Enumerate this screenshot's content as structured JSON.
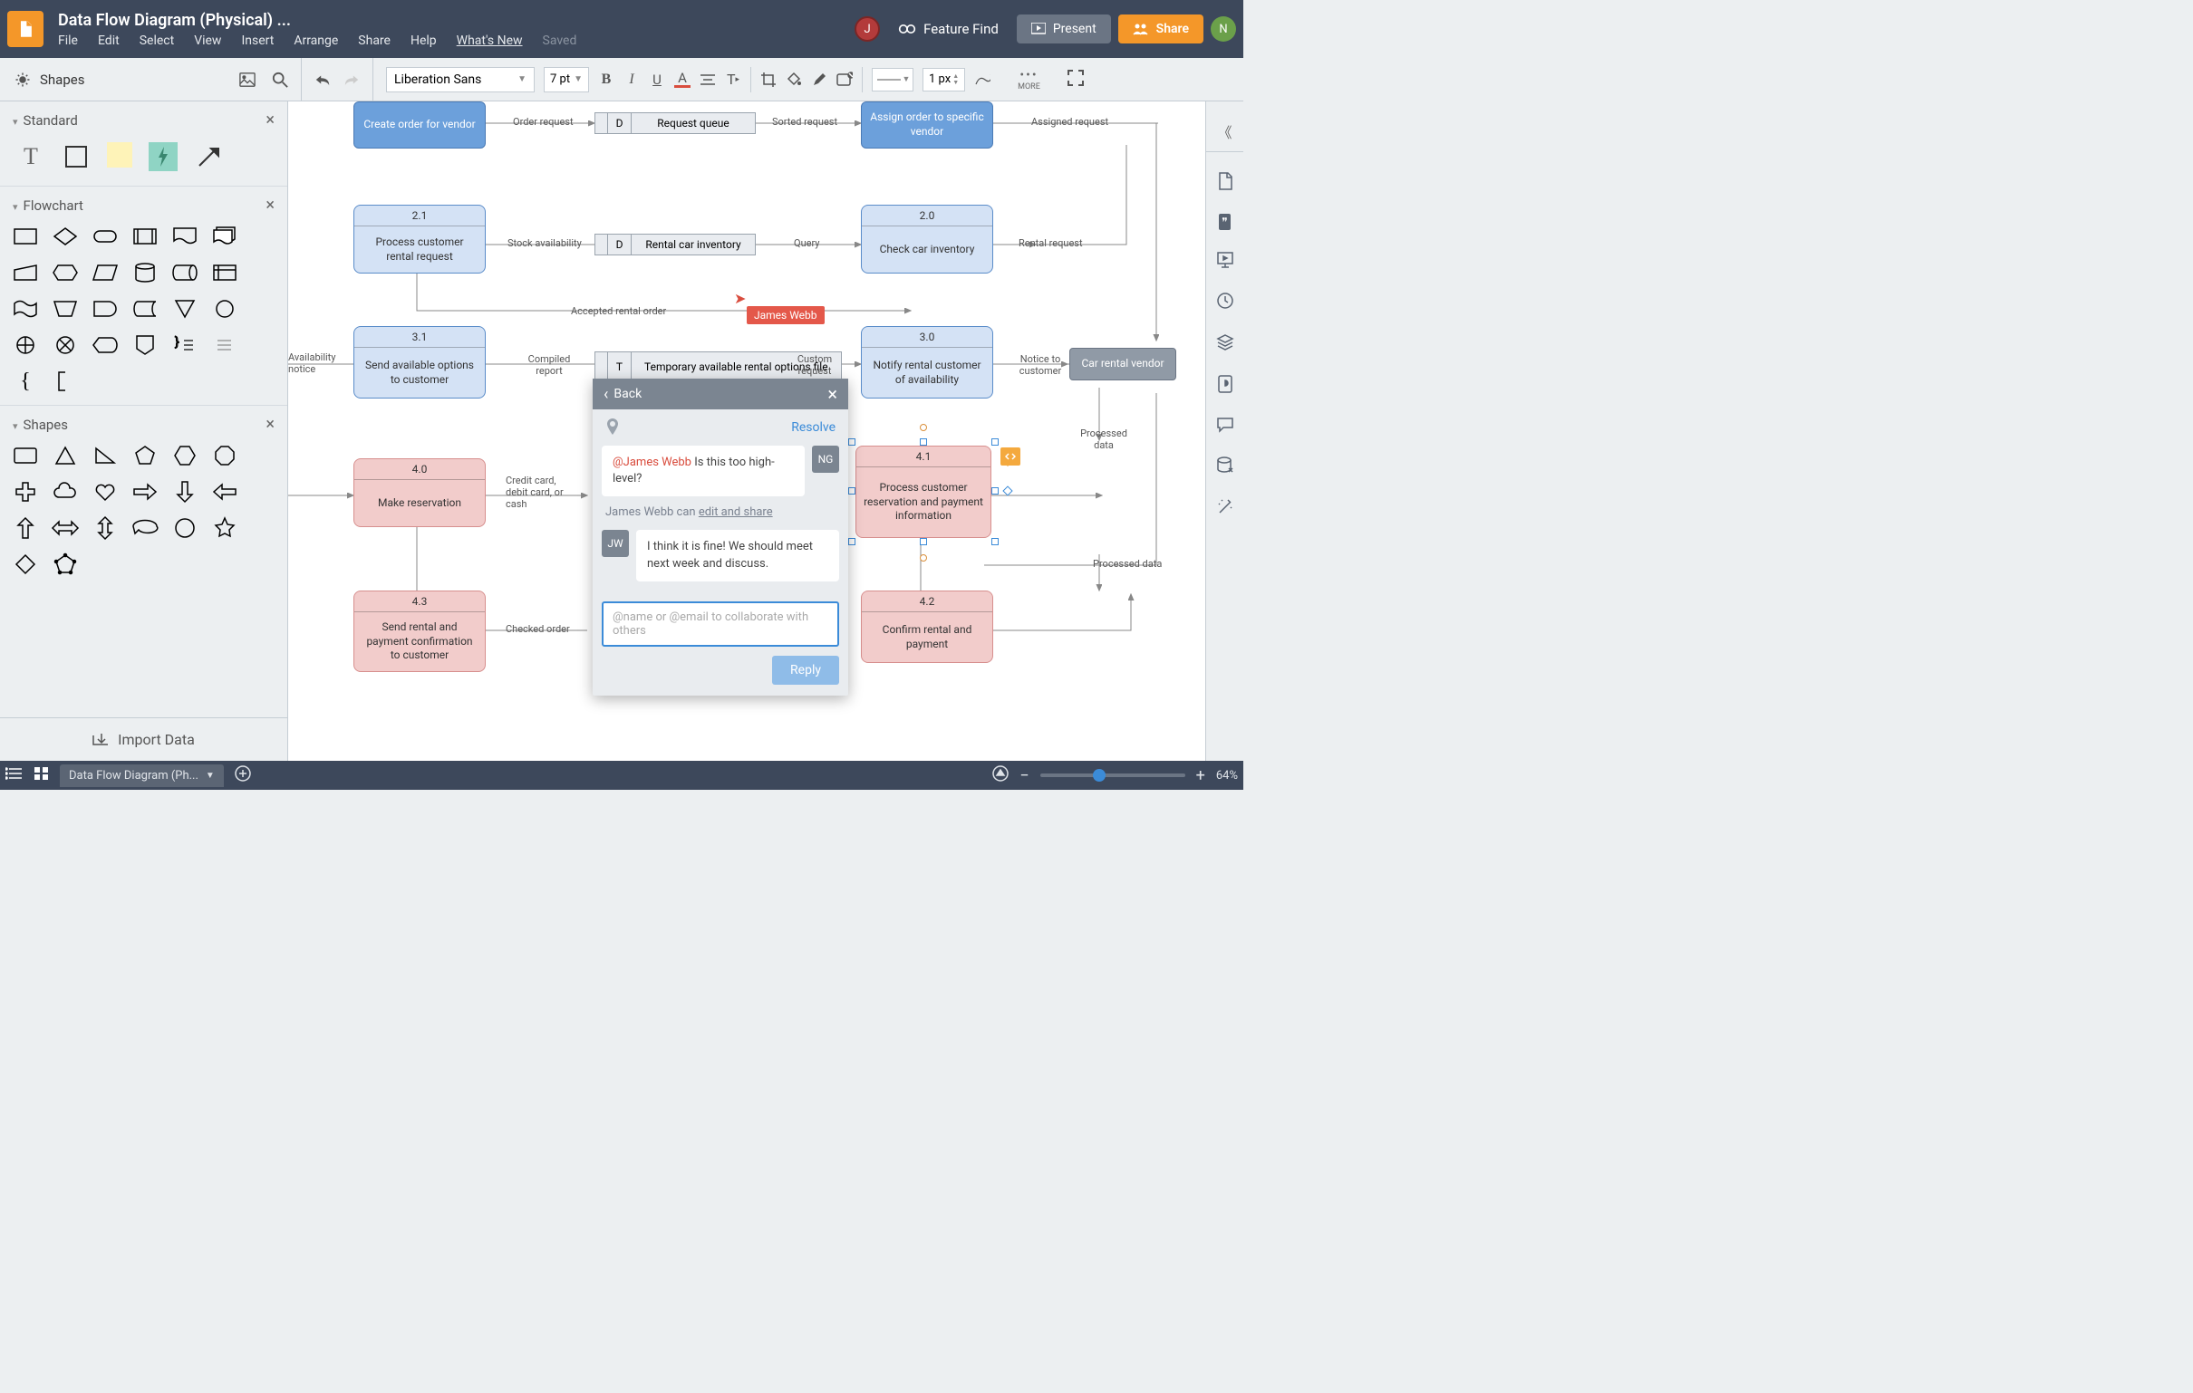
{
  "header": {
    "doc_title": "Data Flow Diagram (Physical) ...",
    "menu": [
      "File",
      "Edit",
      "Select",
      "View",
      "Insert",
      "Arrange",
      "Share",
      "Help",
      "What's New"
    ],
    "saved": "Saved",
    "feature_find": "Feature Find",
    "present": "Present",
    "share": "Share",
    "avatar_j": "J",
    "avatar_n": "N"
  },
  "toolbar": {
    "shapes_label": "Shapes",
    "font": "Liberation Sans",
    "font_size": "7 pt",
    "line_width": "1 px",
    "more": "MORE"
  },
  "left_panel": {
    "standard": "Standard",
    "flowchart": "Flowchart",
    "shapes": "Shapes",
    "import": "Import Data"
  },
  "canvas": {
    "cursor_user": "James Webb",
    "nodes": {
      "create_order": "Create order for vendor",
      "assign_order": "Assign order to specific vendor",
      "n21_num": "2.1",
      "n21_label": "Process customer rental request",
      "n20_num": "2.0",
      "n20_label": "Check car inventory",
      "n31_num": "3.1",
      "n31_label": "Send available options to customer",
      "n30_num": "3.0",
      "n30_label": "Notify rental customer of availability",
      "n40_num": "4.0",
      "n40_label": "Make reservation",
      "n41_num": "4.1",
      "n41_label": "Process customer reservation and payment information",
      "n43_num": "4.3",
      "n43_label": "Send rental and payment confirmation to customer",
      "n42_num": "4.2",
      "n42_label": "Confirm rental and payment",
      "vendor": "Car rental vendor"
    },
    "datastores": {
      "d1_letter": "D",
      "d1_label": "Request queue",
      "d2_letter": "D",
      "d2_label": "Rental car inventory",
      "t1_letter": "T",
      "t1_label": "Temporary available rental options file"
    },
    "edges": {
      "order_request": "Order request",
      "sorted_request": "Sorted request",
      "assigned_request": "Assigned request",
      "stock_availability": "Stock availability",
      "query": "Query",
      "rental_request": "Rental request",
      "accepted_rental": "Accepted rental order",
      "availability_notice": "Availability notice",
      "compiled_report": "Compiled report",
      "custom_request": "Custom request",
      "notice_to_customer": "Notice to customer",
      "credit": "Credit card, debit card, or cash",
      "processed_data1": "Processed data",
      "checked_order": "Checked order",
      "processed_data2": "Processed data"
    }
  },
  "comment": {
    "back": "Back",
    "resolve": "Resolve",
    "c1_avatar": "NG",
    "c1_mention": "@James Webb",
    "c1_text": " Is this too high-level?",
    "share_prefix": "James Webb can ",
    "share_action": "edit and share",
    "c2_avatar": "JW",
    "c2_text": "I think it is fine! We should meet next week and discuss.",
    "placeholder": "@name or @email to collaborate with others",
    "reply": "Reply"
  },
  "bottom": {
    "page_name": "Data Flow Diagram (Ph...",
    "zoom": "64%"
  }
}
